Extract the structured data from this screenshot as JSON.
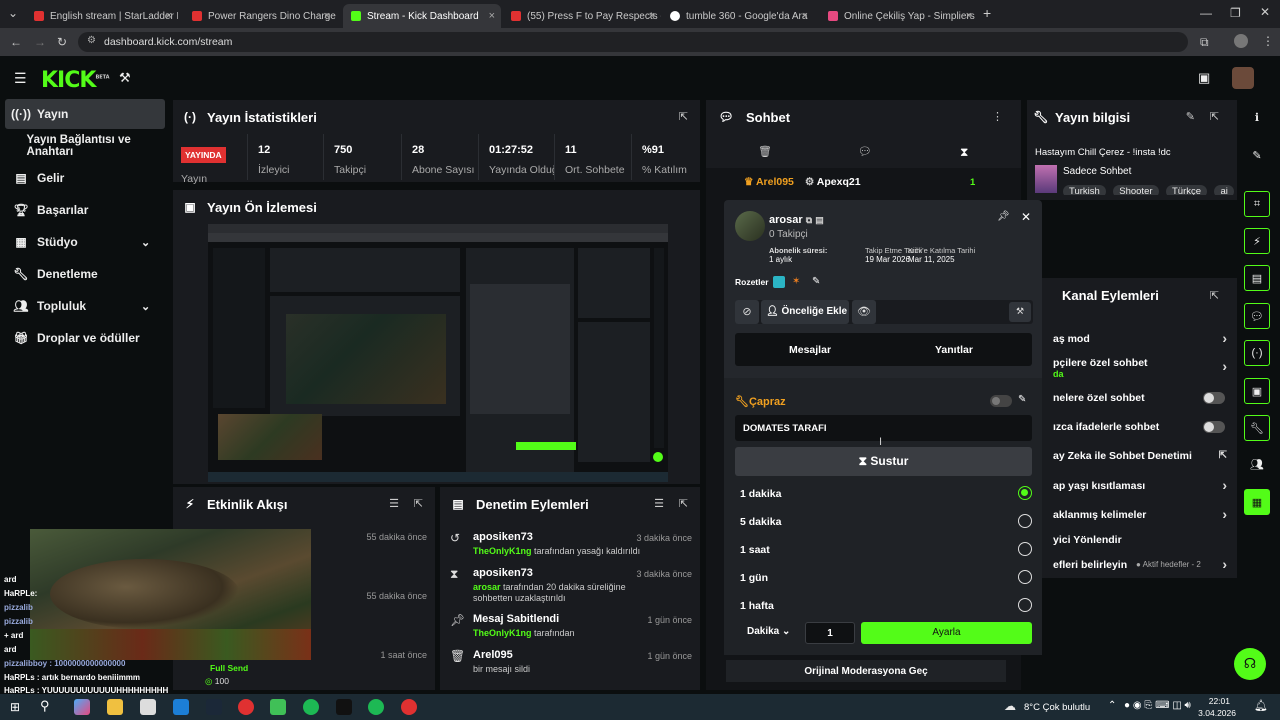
{
  "browser": {
    "tabs": [
      {
        "title": "English stream | StarLadder Bud",
        "color": "#e03131"
      },
      {
        "title": "Power Rangers Dino Charge | S",
        "color": "#e03131"
      },
      {
        "title": "Stream - Kick Dashboard",
        "color": "#53fc18"
      },
      {
        "title": "(55) Press F to Pay Respects - Y",
        "color": "#e03131"
      },
      {
        "title": "tumble 360 - Google'da Ara",
        "color": "#ffffff"
      },
      {
        "title": "Online Çekiliş Yap - Simpliers",
        "color": "#e64980"
      }
    ],
    "new_tab": "+",
    "url": "dashboard.kick.com/stream"
  },
  "kick": {
    "logo": "KICK",
    "beta": "BETA"
  },
  "sidebar": {
    "items": [
      {
        "label": "Yayın",
        "icon": "broadcast-icon"
      },
      {
        "label": "Yayın Bağlantısı ve Anahtarı",
        "icon": ""
      },
      {
        "label": "Gelir",
        "icon": "revenue-icon"
      },
      {
        "label": "Başarılar",
        "icon": "trophy-icon"
      },
      {
        "label": "Stüdyo",
        "icon": "studio-icon"
      },
      {
        "label": "Denetleme",
        "icon": "wrench-icon"
      },
      {
        "label": "Topluluk",
        "icon": "community-icon"
      },
      {
        "label": "Droplar ve ödüller",
        "icon": "gift-icon"
      }
    ]
  },
  "stats": {
    "title": "Yayın İstatistikleri",
    "live_badge": "YAYINDA",
    "live_label": "Yayın",
    "items": [
      {
        "value": "12",
        "label": "İzleyici"
      },
      {
        "value": "750",
        "label": "Takipçi"
      },
      {
        "value": "28",
        "label": "Abone Sayısı"
      },
      {
        "value": "01:27:52",
        "label": "Yayında Olduğu"
      },
      {
        "value": "11",
        "label": "Ort. Sohbete"
      },
      {
        "value": "%91",
        "label": "% Katılım"
      }
    ]
  },
  "preview": {
    "title": "Yayın Ön İzlemesi"
  },
  "activity": {
    "title": "Etkinlik Akışı",
    "times": [
      "55 dakika önce",
      "55 dakika önce",
      "1 saat önce"
    ],
    "item_label": "Full Send",
    "item_value": "100"
  },
  "moderation": {
    "title": "Denetim Eylemleri",
    "items": [
      {
        "title": "aposiken73",
        "user": "TheOnlyK1ng",
        "text": " tarafından yasağı kaldırıldı",
        "time": "3 dakika önce"
      },
      {
        "title": "aposiken73",
        "user": "arosar",
        "text": " tarafından 20 dakika süreliğine sohbetten uzaklaştırıldı",
        "time": "3 dakika önce"
      },
      {
        "title": "Mesaj Sabitlendi",
        "user": "TheOnlyK1ng",
        "text": " tarafından",
        "time": "1 gün önce"
      },
      {
        "title": "Arel095",
        "user": "",
        "text": "bir mesajı sildi",
        "time": "1 gün önce"
      }
    ]
  },
  "chat": {
    "title": "Sohbet",
    "pinned_user1": "Arel095",
    "pinned_user2": "Apexq21",
    "pinned_count": "1"
  },
  "user_popup": {
    "username": "arosar",
    "followers": "0 Takipçi",
    "sub_label": "Abonelik süresi:",
    "sub_value": "1 aylık",
    "follow_label": "Takip Etme Tarihi",
    "follow_value": "19 Mar 2026",
    "join_label": "Kick'e Katılma Tarihi",
    "join_value": "Mar 11, 2025",
    "badges_label": "Rozetler",
    "priority_label": "Önceliğe Ekle",
    "tab_messages": "Mesajlar",
    "tab_replies": "Yanıtlar",
    "section_title": "Çapraz",
    "input_value": "DOMATES TARAFI",
    "mute_button": "Sustur",
    "durations": [
      {
        "label": "1 dakika",
        "selected": true
      },
      {
        "label": "5 dakika",
        "selected": false
      },
      {
        "label": "1 saat",
        "selected": false
      },
      {
        "label": "1 gün",
        "selected": false
      },
      {
        "label": "1 hafta",
        "selected": false
      }
    ],
    "unit_label": "Dakika",
    "custom_value": "1",
    "apply_button": "Ayarla",
    "original_mod": "Orijinal Moderasyona Geç"
  },
  "stream_info": {
    "title": "Yayın bilgisi",
    "stream_title": "Hastayım Chill Çerez - !insta !dc",
    "category": "Sadece Sohbet",
    "tags": [
      "Turkish",
      "Shooter",
      "Türkçe",
      "ai"
    ]
  },
  "channel_actions": {
    "title": "Kanal Eylemleri",
    "items": [
      {
        "label": "aş mod",
        "kind": "arrow"
      },
      {
        "label": "pçilere özel sohbet",
        "kind": "arrow",
        "sub": "da"
      },
      {
        "label": "nelere özel sohbet",
        "kind": "toggle"
      },
      {
        "label": "ızca ifadelerle sohbet",
        "kind": "toggle"
      },
      {
        "label": "ay Zeka ile Sohbet Denetimi",
        "kind": "external"
      },
      {
        "label": "ap yaşı kısıtlaması",
        "kind": "arrow"
      },
      {
        "label": "aklanmış kelimeler",
        "kind": "arrow"
      },
      {
        "label": "yici Yönlendir",
        "kind": "none"
      },
      {
        "label": "efleri belirleyin",
        "kind": "arrow",
        "badge": "● Aktif hedefler - 2"
      }
    ]
  },
  "overlay_chat": [
    "ard",
    "HaRPLe:",
    "pizzalib",
    "pizzalib",
    "+ ard",
    "ard",
    "pizzalibboy : 1000000000000000",
    "HaRPLs : artık bernardo beniiimmm",
    "HaRPLs : YUUUUUUUUUUUUHHHHHHHHH"
  ],
  "taskbar": {
    "weather": "8°C  Çok bulutlu",
    "time": "22:01",
    "date": "3.04.2026"
  }
}
